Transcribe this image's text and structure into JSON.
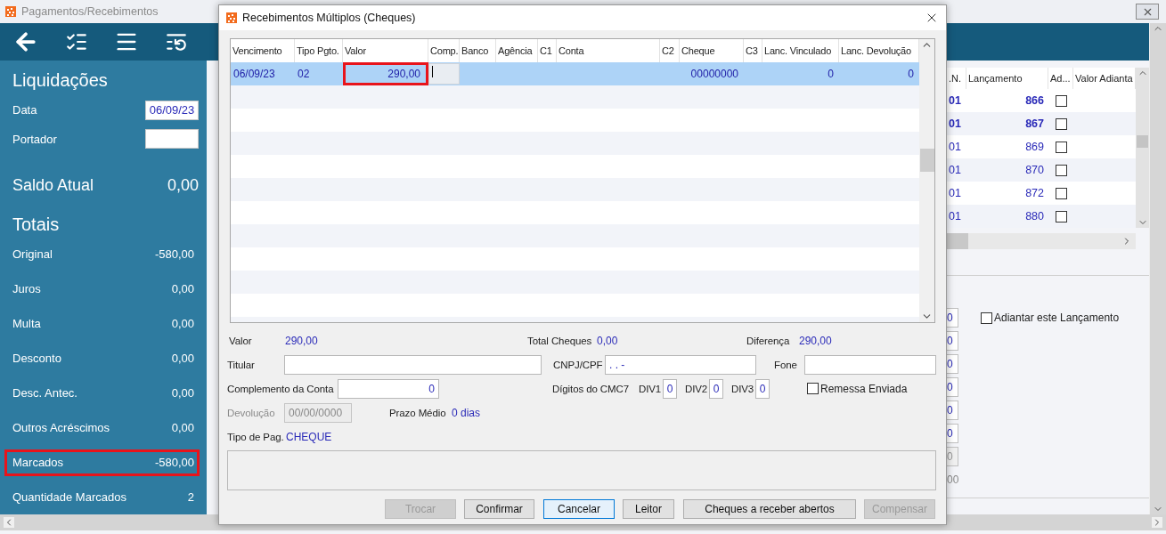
{
  "app": {
    "title": "Pagamentos/Recebimentos"
  },
  "sidebar": {
    "heading": "Liquidações",
    "fields": [
      {
        "label": "Data",
        "value": "06/09/23"
      },
      {
        "label": "Portador"
      }
    ],
    "balance": {
      "label": "Saldo Atual",
      "value": "0,00"
    },
    "totals_heading": "Totais",
    "totals": [
      {
        "label": "Original",
        "value": "-580,00",
        "highlighted": false
      },
      {
        "label": "Juros",
        "value": "0,00",
        "highlighted": false
      },
      {
        "label": "Multa",
        "value": "0,00",
        "highlighted": false
      },
      {
        "label": "Desconto",
        "value": "0,00",
        "highlighted": false
      },
      {
        "label": "Desc. Antec.",
        "value": "0,00",
        "highlighted": false
      },
      {
        "label": "Outros Acréscimos",
        "value": "0,00",
        "highlighted": false
      },
      {
        "label": "Marcados",
        "value": "-580,00",
        "highlighted": true
      },
      {
        "label": "Quantidade Marcados",
        "value": "2",
        "highlighted": false
      }
    ]
  },
  "launch_table": {
    "columns": [
      ".N.",
      "Lançamento",
      "Ad...",
      "Valor Adianta"
    ],
    "rows": [
      {
        "cells": [
          "01",
          "866"
        ],
        "bold": true,
        "checked": false
      },
      {
        "cells": [
          "01",
          "867"
        ],
        "bold": true,
        "checked": false
      },
      {
        "cells": [
          "01",
          "869"
        ],
        "bold": false,
        "checked": false
      },
      {
        "cells": [
          "01",
          "870"
        ],
        "bold": false,
        "checked": false
      },
      {
        "cells": [
          "01",
          "872"
        ],
        "bold": false,
        "checked": false
      },
      {
        "cells": [
          "01",
          "880"
        ],
        "bold": false,
        "checked": false
      }
    ]
  },
  "value_fields": [
    {
      "value": "0",
      "disabled": false
    },
    {
      "value": "0",
      "disabled": false
    },
    {
      "value": "0",
      "disabled": false
    },
    {
      "value": "0",
      "disabled": false
    },
    {
      "value": "0",
      "disabled": false
    },
    {
      "value": "0",
      "disabled": false
    },
    {
      "value": "0",
      "disabled": true
    }
  ],
  "value_total": "00",
  "advance_checkbox": {
    "label": "Adiantar este Lançamento",
    "checked": false
  },
  "dialog": {
    "title": "Recebimentos Múltiplos (Cheques)",
    "columns": [
      "Vencimento",
      "Tipo Pgto.",
      "Valor",
      "Comp.",
      "Banco",
      "Agência",
      "C1",
      "Conta",
      "C2",
      "Cheque",
      "C3",
      "Lanc. Vinculado",
      "Lanc. Devolução"
    ],
    "rows": [
      {
        "selected": true,
        "vencimento": "06/09/23",
        "tipo": "02",
        "valor": "290,00",
        "valor_marked": true,
        "comp_editing": true,
        "cheque": "00000000",
        "lanc_vinculado": "0",
        "lanc_devolucao": "0"
      }
    ],
    "summary": [
      {
        "label": "Valor",
        "value": "290,00"
      },
      {
        "label": "Total Cheques",
        "value": "0,00"
      },
      {
        "label": "Diferença",
        "value": "290,00"
      }
    ],
    "titular": {
      "label": "Titular"
    },
    "cnpj": {
      "label": "CNPJ/CPF",
      "value": ".  .  -"
    },
    "fone": {
      "label": "Fone"
    },
    "complemento": {
      "label": "Complemento da Conta",
      "value": "0"
    },
    "cmc7": {
      "label": "Dígitos do CMC7",
      "digits": [
        {
          "label": "DIV1",
          "value": "0"
        },
        {
          "label": "DIV2",
          "value": "0"
        },
        {
          "label": "DIV3",
          "value": "0"
        }
      ]
    },
    "remessa": {
      "label": "Remessa Enviada",
      "checked": false
    },
    "devolucao": {
      "label": "Devolução",
      "value": "00/00/0000",
      "disabled": true
    },
    "prazo": {
      "label": "Prazo Médio",
      "value": "0 dias"
    },
    "tipo": {
      "label": "Tipo de Pag.",
      "value": "CHEQUE"
    },
    "buttons": [
      {
        "label": "Trocar",
        "disabled": true,
        "focused": false
      },
      {
        "label": "Confirmar",
        "disabled": false,
        "focused": false
      },
      {
        "label": "Cancelar",
        "disabled": false,
        "focused": true
      },
      {
        "label": "Leitor",
        "disabled": false,
        "focused": false
      },
      {
        "label": "Cheques a receber abertos",
        "disabled": false,
        "focused": false
      },
      {
        "label": "Compensar",
        "disabled": true,
        "focused": false
      }
    ]
  }
}
